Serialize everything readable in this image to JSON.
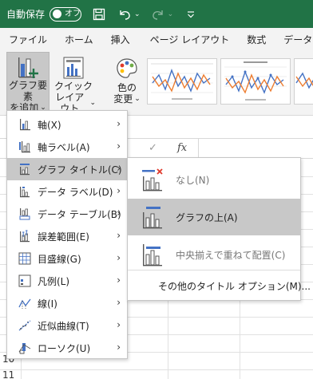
{
  "titlebar": {
    "autosave_label": "自動保存",
    "toggle_text": "オフ",
    "background_color": "#217346"
  },
  "tabs": [
    "ファイル",
    "ホーム",
    "挿入",
    "ページ レイアウト",
    "数式",
    "データ"
  ],
  "ribbon": {
    "add_element": {
      "line1": "グラフ要素",
      "line2": "を追加"
    },
    "quick_layout": {
      "line1": "クイック",
      "line2": "レイアウト"
    },
    "change_color": {
      "line1": "色の",
      "line2": "変更"
    }
  },
  "formula_bar": {
    "fx": "fx",
    "enter_symbol": "✓"
  },
  "row_numbers": [
    "10",
    "11"
  ],
  "element_menu": {
    "items": [
      {
        "label": "軸(X)",
        "icon": "axes-icon"
      },
      {
        "label": "軸ラベル(A)",
        "icon": "axis-title-icon"
      },
      {
        "label": "グラフ タイトル(C)",
        "icon": "chart-title-icon"
      },
      {
        "label": "データ ラベル(D)",
        "icon": "data-labels-icon"
      },
      {
        "label": "データ テーブル(B)",
        "icon": "data-table-icon"
      },
      {
        "label": "誤差範囲(E)",
        "icon": "error-bars-icon"
      },
      {
        "label": "目盛線(G)",
        "icon": "gridlines-icon"
      },
      {
        "label": "凡例(L)",
        "icon": "legend-icon"
      },
      {
        "label": "線(I)",
        "icon": "lines-icon"
      },
      {
        "label": "近似曲線(T)",
        "icon": "trendline-icon"
      },
      {
        "label": "ローソク(U)",
        "icon": "up-down-bars-icon"
      }
    ],
    "selected_index": 2
  },
  "title_submenu": {
    "none_label": "なし(N)",
    "above_label": "グラフの上(A)",
    "overlay_label": "中央揃えで重ねて配置(C)",
    "more_options": "その他のタイトル オプション(M)..."
  }
}
